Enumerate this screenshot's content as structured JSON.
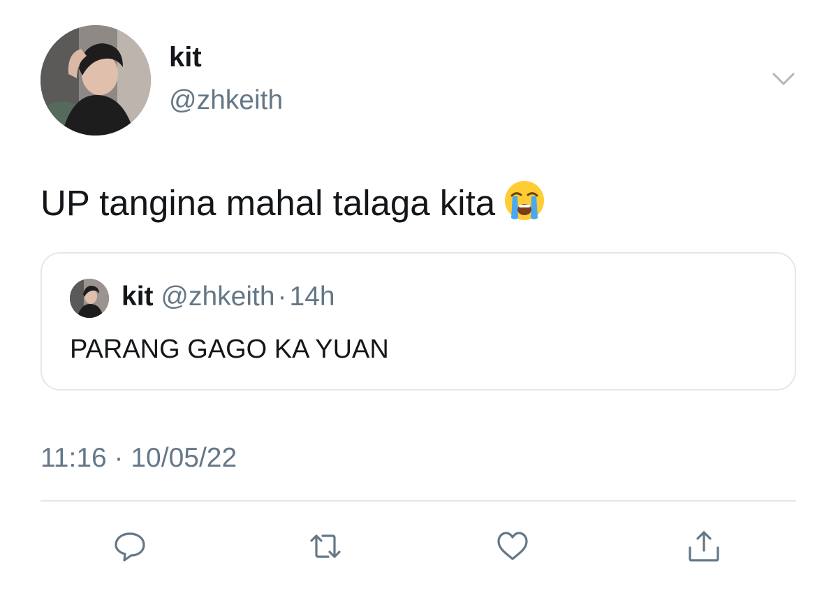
{
  "tweet": {
    "author": {
      "display_name": "kit",
      "handle": "@zhkeith"
    },
    "text": "UP tangina mahal talaga kita",
    "emoji": "loudly-crying-face",
    "timestamp": "11:16 · 10/05/22"
  },
  "quoted_tweet": {
    "display_name": "kit",
    "handle": "@zhkeith",
    "separator": "·",
    "age": "14h",
    "text": "PARANG GAGO KA YUAN"
  },
  "actions": {
    "reply_icon": "speech-bubble-icon",
    "retweet_icon": "retweet-icon",
    "like_icon": "heart-icon",
    "share_icon": "share-icon"
  },
  "colors": {
    "primary_text": "#14171a",
    "secondary_text": "#657786",
    "border": "#e1e8ed",
    "icon": "#657786"
  }
}
